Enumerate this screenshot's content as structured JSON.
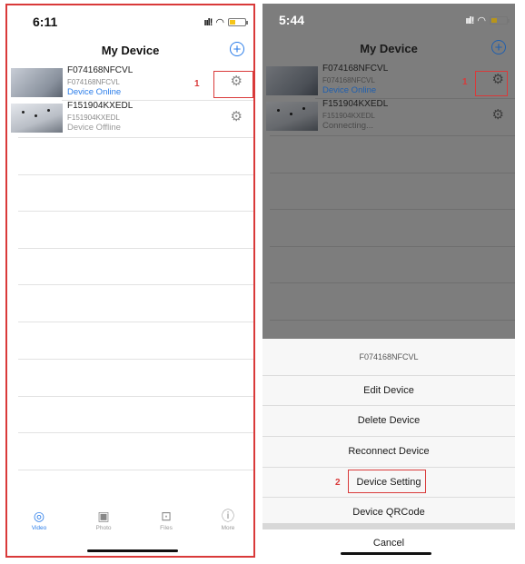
{
  "left": {
    "status_time": "6:11",
    "nav_title": "My Device",
    "add_icon_glyph": "+",
    "devices": [
      {
        "name": "F074168NFCVL",
        "id": "F074168NFCVL",
        "status": "Device Online"
      },
      {
        "name": "F151904KXEDL",
        "id": "F151904KXEDL",
        "status": "Device Offline"
      }
    ],
    "annotation_1": "1",
    "tabs": [
      {
        "label": "Video",
        "icon": "camera-icon",
        "glyph": "◎"
      },
      {
        "label": "Photo",
        "icon": "photo-icon",
        "glyph": "▣"
      },
      {
        "label": "Files",
        "icon": "files-icon",
        "glyph": "⊡"
      },
      {
        "label": "More",
        "icon": "more-icon",
        "glyph": "ⓘ"
      }
    ]
  },
  "right": {
    "status_time": "5:44",
    "nav_title": "My Device",
    "add_icon_glyph": "+",
    "devices": [
      {
        "name": "F074168NFCVL",
        "id": "F074168NFCVL",
        "status": "Device Online"
      },
      {
        "name": "F151904KXEDL",
        "id": "F151904KXEDL",
        "status": "Connecting..."
      }
    ],
    "annotation_1": "1",
    "sheet": {
      "title": "F074168NFCVL",
      "items": [
        "Edit Device",
        "Delete Device",
        "Reconnect Device",
        "Device Setting",
        "Device QRCode"
      ],
      "cancel": "Cancel",
      "annotation_2": "2"
    }
  },
  "colors": {
    "accent": "#2b7de9",
    "annotation_red": "#d93a3a",
    "battery": "#f5c518"
  }
}
